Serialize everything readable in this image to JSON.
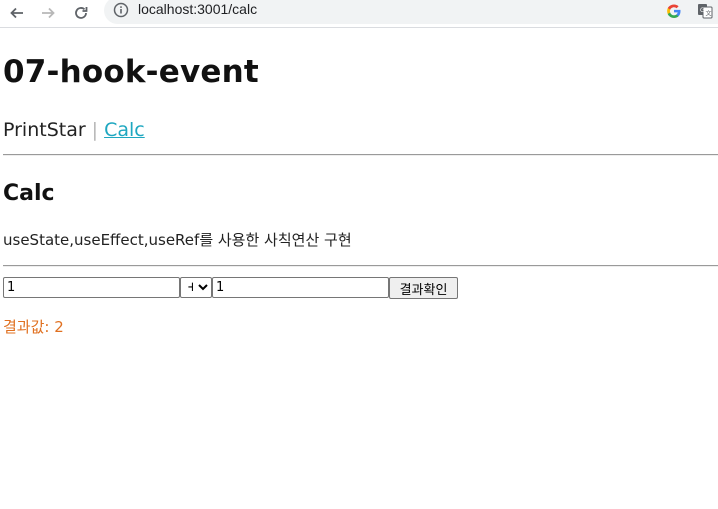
{
  "browser": {
    "url": "localhost:3001/calc"
  },
  "page": {
    "title": "07-hook-event",
    "nav": {
      "items": [
        {
          "label": "PrintStar"
        },
        {
          "label": "Calc"
        }
      ],
      "separator": "|"
    },
    "section_title": "Calc",
    "description": "useState,useEffect,useRef를 사용한 사칙연산 구현",
    "form": {
      "input_a": "1",
      "operator": "+",
      "operator_options": [
        "+"
      ],
      "input_b": "1",
      "submit_label": "결과확인"
    },
    "result_label": "결과값: 2"
  },
  "colors": {
    "link": "#1ea7c0",
    "result": "#e07020"
  },
  "icons": [
    "back-arrow-icon",
    "forward-arrow-icon",
    "reload-icon",
    "info-icon",
    "google-icon",
    "translate-icon"
  ]
}
